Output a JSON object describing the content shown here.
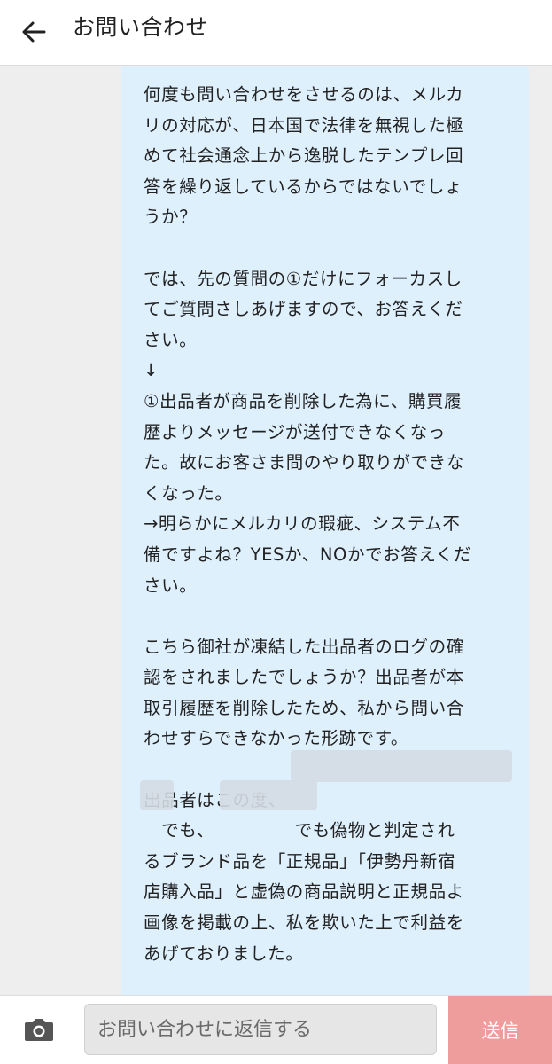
{
  "header": {
    "title": "お問い合わせ",
    "back_icon": "arrow-left-icon"
  },
  "message": {
    "text": "何度も問い合わせをさせるのは、メルカ\nリの対応が、日本国で法律を無視した極\nめて社会通念上から逸脱したテンプレ回\n答を繰り返しているからではないでしょ\nうか？\n\nでは、先の質問の①だけにフォーカスし\nてご質問さしあげますので、お答えくだ\nさい。\n↓\n①出品者が商品を削除した為に、購買履\n歴よりメッセージが送付できなくなっ\nた。故にお客さま間のやり取りができな\nくなった。\n→明らかにメルカリの瑕疵、システム不\n備ですよね？YESか、NOかでお答えくだ\nさい。\n\nこちら御社が凍結した出品者のログの確\n認をされましたでしょうか？出品者が本\n取引履歴を削除したため、私から問い合\nわせすらできなかった形跡です。\n\n出品者はこの度、\n　でも、　　　　　でも偽物と判定され\nるブランド品を「正規品」「伊勢丹新宿\n店購入品」と虚偽の商品説明と正規品よ\n画像を掲載の上、私を欺いた上で利益を\nあげておりました。\n\nその上で、購買履歴自体を削除し、メッ"
  },
  "footer": {
    "camera_icon": "camera-icon",
    "input_placeholder": "お問い合わせに返信する",
    "send_label": "送信"
  },
  "colors": {
    "bubble_background": "#dff0fd",
    "chat_background": "#eeeeee",
    "send_button": "#ef9c9c",
    "redaction": "#d4dce4"
  }
}
